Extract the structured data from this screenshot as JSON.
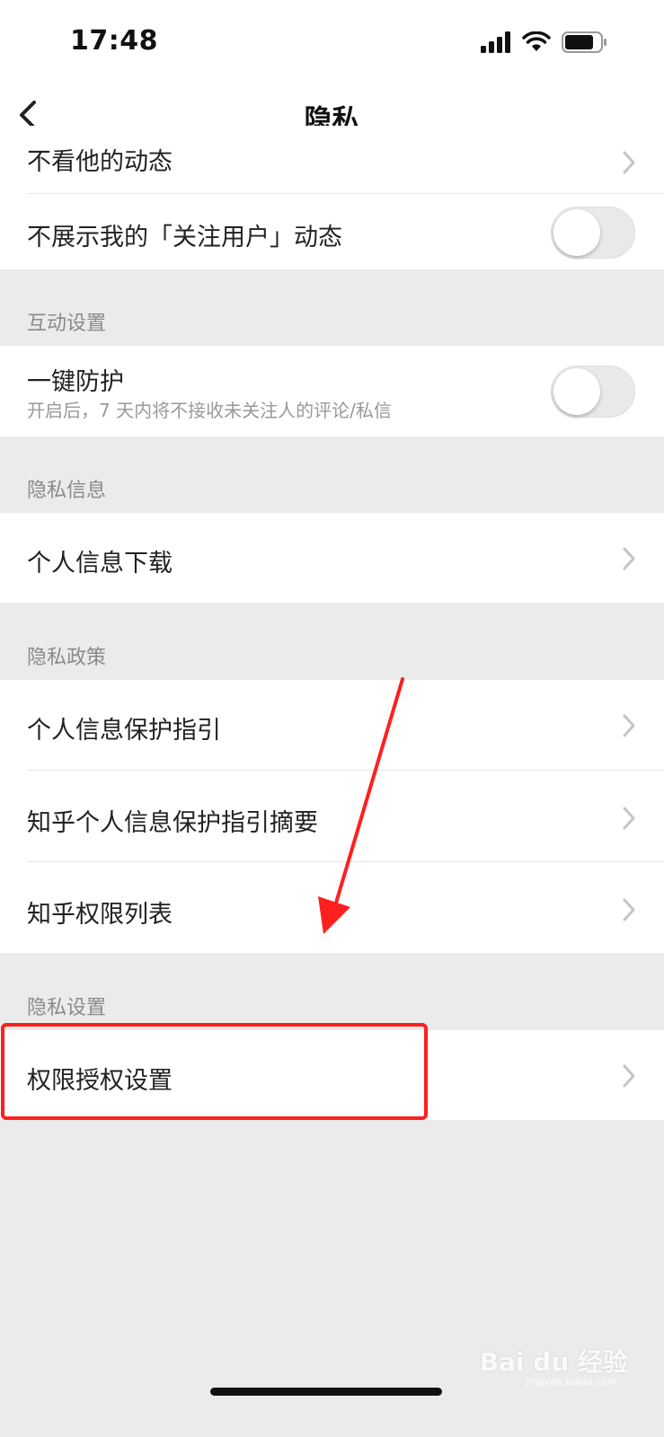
{
  "status_bar": {
    "time": "17:48"
  },
  "nav": {
    "title": "隐私"
  },
  "rows_top": {
    "partial_label": "不看他的动态",
    "follow_label": "不展示我的「关注用户」动态"
  },
  "sections": {
    "interaction": "互动设置",
    "privacy_info": "隐私信息",
    "privacy_policy": "隐私政策",
    "privacy_settings": "隐私设置"
  },
  "protection": {
    "label": "一键防护",
    "sublabel": "开启后，7 天内将不接收未关注人的评论/私信"
  },
  "items": {
    "download": "个人信息下载",
    "guide": "个人信息保护指引",
    "guide_summary": "知乎个人信息保护指引摘要",
    "permission_list": "知乎权限列表",
    "permission_settings": "权限授权设置"
  },
  "toggles": {
    "follow_dynamic": false,
    "one_key_protection": false
  },
  "watermark": {
    "brand": "Bai du 经验",
    "url": "jingyan.baidu.com"
  },
  "colors": {
    "highlight": "#ff1f1f",
    "background": "#ebebeb"
  }
}
